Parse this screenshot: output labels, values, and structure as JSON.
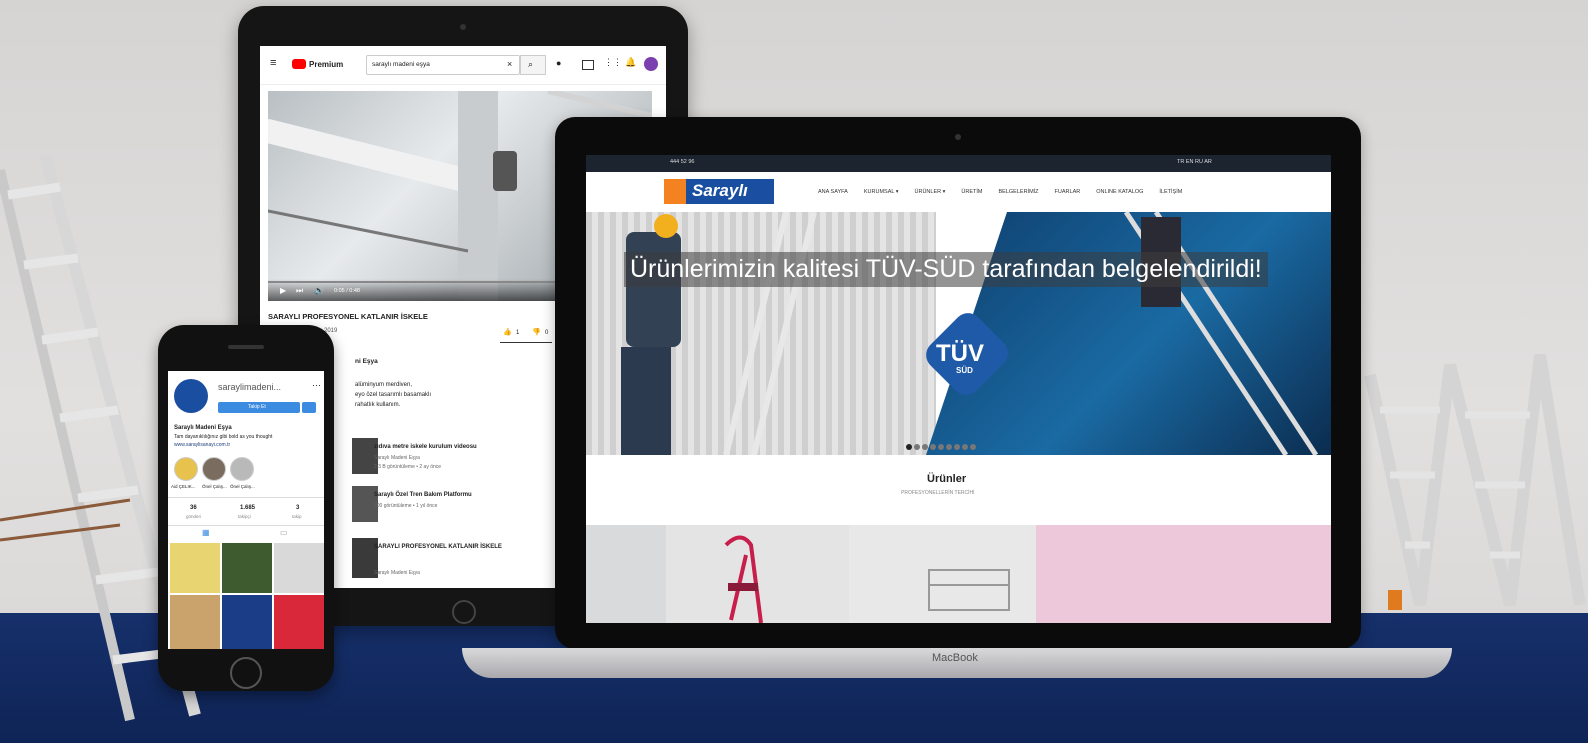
{
  "youtube": {
    "logo_label": "Premium",
    "search_value": "saraylı madeni eşya",
    "time": "0:05 / 0:48",
    "video_title": "SARAYLI PROFESYONEL KATLANIR İSKELE",
    "date": "Kas 2019",
    "likes": "1",
    "dislikes": "0",
    "channel": "ni Eşya",
    "description": [
      "alüminyum merdiven,",
      "eyo özel tasarımlı basamaklı",
      "rahatlık kullanım."
    ],
    "related": [
      {
        "title": "zıdıva metre iskele kurulum videosu",
        "meta": "Saraylı Madeni Eşya",
        "meta2": "2,3 B görüntüleme • 2 ay önce"
      },
      {
        "title": "Saraylı Özel Tren Bakım Platformu",
        "meta": "300 görüntüleme • 1 yıl önce"
      },
      {
        "title": "SARAYLI PROFESYONEL KATLANIR İSKELE",
        "meta": "Saraylı Madeni Eşya"
      }
    ]
  },
  "website": {
    "topbar_phone": "444 52 96",
    "topbar_langs": "TR EN RU AR",
    "logo": "Saraylı",
    "nav": [
      "ANA SAYFA",
      "KURUMSAL ▾",
      "ÜRÜNLER ▾",
      "ÜRETİM",
      "BELGELERİMİZ",
      "FUARLAR",
      "ONLINE KATALOG",
      "İLETİŞİM"
    ],
    "slide_text": "Ürünlerimizin kalitesi TÜV-SÜD tarafından belgelendirildi!",
    "tuv_label": "TÜV",
    "sud_label": "SÜD",
    "section_title": "Ürünler",
    "section_sub": "PROFESYONELLERİN TERCİHİ",
    "macbook_label": "MacBook"
  },
  "instagram": {
    "username": "saraylimadeni...",
    "follow_label": "Takip Et",
    "bio_name": "Saraylı Madeni Eşya",
    "bio_line": "Tam dayanıklılığınız gibi bold as you thought",
    "bio_link": "www.saraylisanayi.com.tr",
    "highlights": [
      "Aid ÇELIK...",
      "Önel Çalış...",
      "Önel Çalış..."
    ],
    "stats": [
      {
        "value": "36",
        "label": "gönderi"
      },
      {
        "value": "1.685",
        "label": "takipçi"
      },
      {
        "value": "3",
        "label": "takip"
      }
    ]
  },
  "colors": {
    "youtube_red": "#ff0000",
    "brand_orange": "#f58220",
    "brand_blue": "#1a4ea1",
    "floor_navy": "#16306b",
    "tuv_blue": "#1f5aa8"
  }
}
